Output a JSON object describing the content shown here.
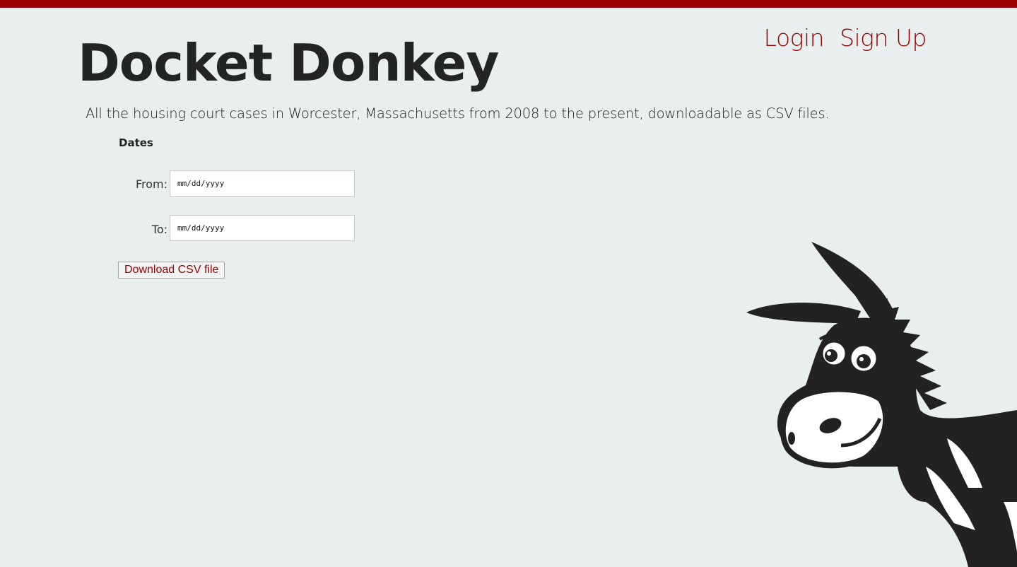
{
  "header": {
    "title": "Docket Donkey",
    "nav": {
      "login": "Login",
      "signup": "Sign Up"
    }
  },
  "main": {
    "tagline": "All the housing court cases in Worcester, Massachusetts from 2008 to the present, downloadable as CSV files.",
    "dates_heading": "Dates",
    "from_label": "From:",
    "to_label": "To:",
    "from_placeholder": "mm/dd/yyyy",
    "to_placeholder": "mm/dd/yyyy",
    "download_label": "Download CSV file"
  },
  "colors": {
    "accent": "#990000",
    "background": "#e9eeee",
    "text": "#232425"
  },
  "icons": {
    "mascot": "donkey-mascot-icon"
  }
}
